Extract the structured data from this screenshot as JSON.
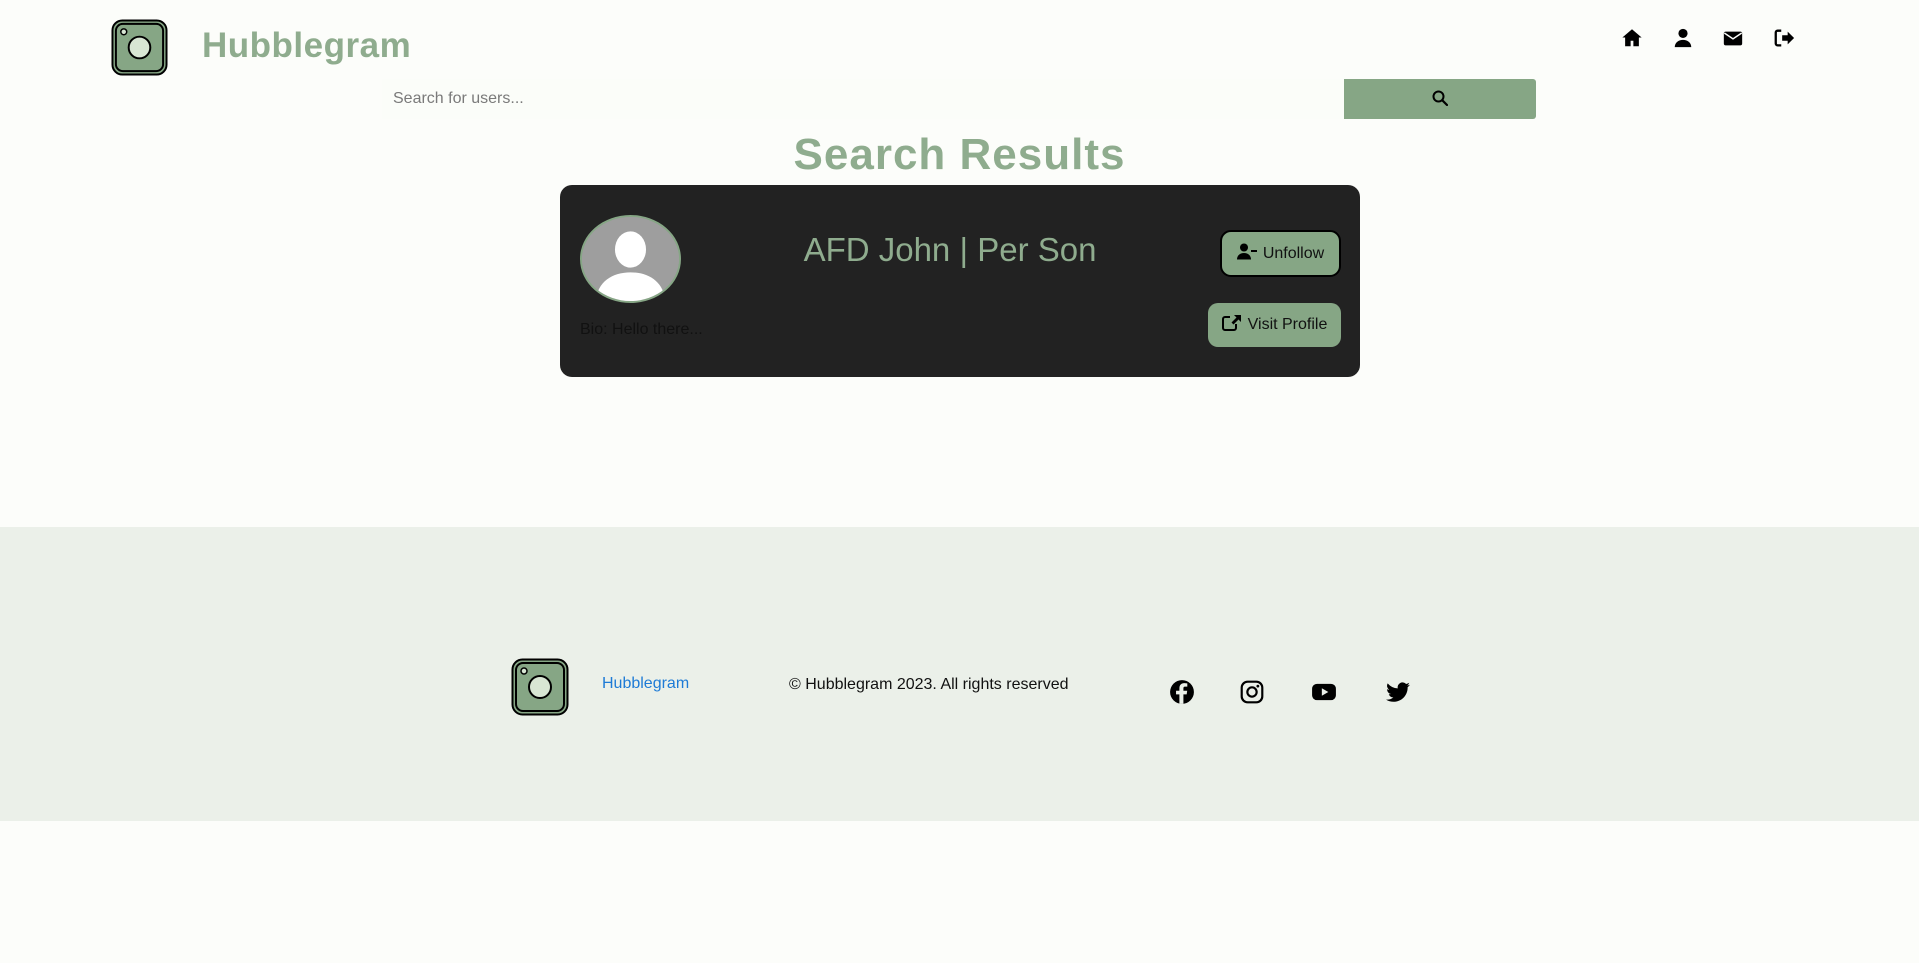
{
  "header": {
    "brand": "Hubblegram",
    "nav_icons": [
      "home-icon",
      "user-icon",
      "envelope-icon",
      "sign-out-icon"
    ]
  },
  "search": {
    "placeholder": "Search for users...",
    "value": ""
  },
  "results": {
    "title": "Search Results",
    "items": [
      {
        "name": "AFD John | Per Son",
        "bio": "Bio: Hello there...",
        "unfollow_label": "Unfollow",
        "visit_label": "Visit Profile"
      }
    ]
  },
  "footer": {
    "brand": "Hubblegram",
    "copyright": "© Hubblegram 2023. All rights reserved",
    "social_icons": [
      "facebook-icon",
      "instagram-icon",
      "youtube-icon",
      "twitter-icon"
    ]
  },
  "colors": {
    "accent": "#86a685",
    "brand_text": "#8fac8e",
    "card": "#222222",
    "footer_bg": "#ebf0e9",
    "link": "#1e7bd6"
  }
}
